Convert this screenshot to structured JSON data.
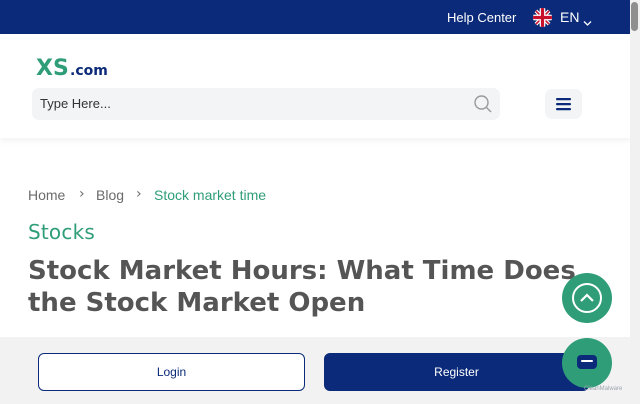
{
  "topbar": {
    "help_label": "Help Center",
    "lang_label": "EN",
    "flag_icon": "uk-flag-icon",
    "color": "#0b2b7a"
  },
  "header": {
    "logo_text": "XS",
    "logo_suffix": ".com",
    "search_placeholder": "Type Here..."
  },
  "breadcrumb": {
    "items": [
      "Home",
      "Blog",
      "Stock market time"
    ],
    "separator": "›"
  },
  "article": {
    "category": "Stocks",
    "title": "Stock Market Hours: What Time Does the Stock Market Open"
  },
  "footer": {
    "login_label": "Login",
    "register_label": "Register"
  },
  "widgets": {
    "scroll_top_icon": "chevron-up-icon",
    "chat_icon": "chat-icon",
    "badge_text": "CleanMalware"
  },
  "colors": {
    "brand_blue": "#0b2b7a",
    "accent_green": "#2f9e78"
  }
}
